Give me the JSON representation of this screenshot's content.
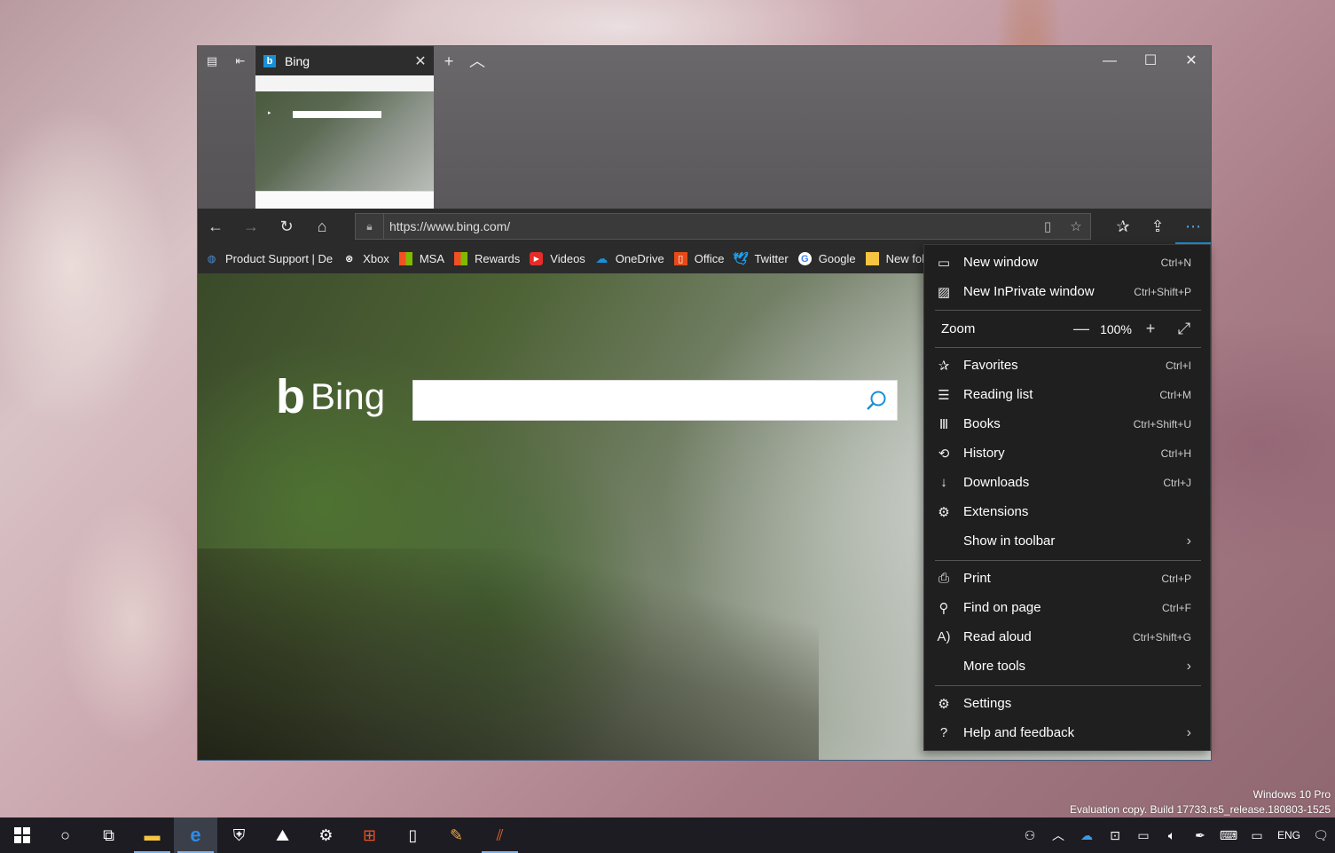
{
  "browser": {
    "tab": {
      "title": "Bing",
      "favicon": "bing-favicon"
    },
    "address": {
      "url": "https://www.bing.com/"
    },
    "favorites": [
      {
        "label": "Product Support | De",
        "icon": "globe-icon",
        "color": "#4a8fd6"
      },
      {
        "label": "Xbox",
        "icon": "xbox-icon",
        "color": "#ffffff"
      },
      {
        "label": "MSA",
        "icon": "microsoft-icon",
        "color": "#f25022"
      },
      {
        "label": "Rewards",
        "icon": "microsoft-icon",
        "color": "#f25022"
      },
      {
        "label": "Videos",
        "icon": "youtube-icon",
        "color": "#e52d27"
      },
      {
        "label": "OneDrive",
        "icon": "cloud-icon",
        "color": "#1a8fd6"
      },
      {
        "label": "Office",
        "icon": "office-icon",
        "color": "#e64a19"
      },
      {
        "label": "Twitter",
        "icon": "twitter-icon",
        "color": "#1da1f2"
      },
      {
        "label": "Google",
        "icon": "google-icon",
        "color": "#ffffff"
      },
      {
        "label": "New fol",
        "icon": "folder-icon",
        "color": "#f5c542"
      }
    ],
    "page": {
      "logo": "Bing"
    }
  },
  "menu": {
    "items_top": [
      {
        "label": "New window",
        "shortcut": "Ctrl+N",
        "icon": "window-icon"
      },
      {
        "label": "New InPrivate window",
        "shortcut": "Ctrl+Shift+P",
        "icon": "inprivate-icon"
      }
    ],
    "zoom": {
      "label": "Zoom",
      "value": "100%"
    },
    "items_mid": [
      {
        "label": "Favorites",
        "shortcut": "Ctrl+I",
        "icon": "favorites-icon"
      },
      {
        "label": "Reading list",
        "shortcut": "Ctrl+M",
        "icon": "reading-list-icon"
      },
      {
        "label": "Books",
        "shortcut": "Ctrl+Shift+U",
        "icon": "books-icon"
      },
      {
        "label": "History",
        "shortcut": "Ctrl+H",
        "icon": "history-icon"
      },
      {
        "label": "Downloads",
        "shortcut": "Ctrl+J",
        "icon": "download-icon"
      },
      {
        "label": "Extensions",
        "shortcut": "",
        "icon": "extensions-icon"
      },
      {
        "label": "Show in toolbar",
        "shortcut": "",
        "icon": ""
      }
    ],
    "items_tools": [
      {
        "label": "Print",
        "shortcut": "Ctrl+P",
        "icon": "print-icon"
      },
      {
        "label": "Find on page",
        "shortcut": "Ctrl+F",
        "icon": "search-icon"
      },
      {
        "label": "Read aloud",
        "shortcut": "Ctrl+Shift+G",
        "icon": "read-aloud-icon"
      },
      {
        "label": "More tools",
        "shortcut": "",
        "icon": ""
      }
    ],
    "items_bottom": [
      {
        "label": "Settings",
        "shortcut": "",
        "icon": "gear-icon"
      },
      {
        "label": "Help and feedback",
        "shortcut": "",
        "icon": "help-icon"
      }
    ]
  },
  "watermark": {
    "line1": "Windows 10 Pro",
    "line2": "Evaluation copy. Build 17733.rs5_release.180803-1525"
  },
  "taskbar": {
    "language": "ENG"
  }
}
